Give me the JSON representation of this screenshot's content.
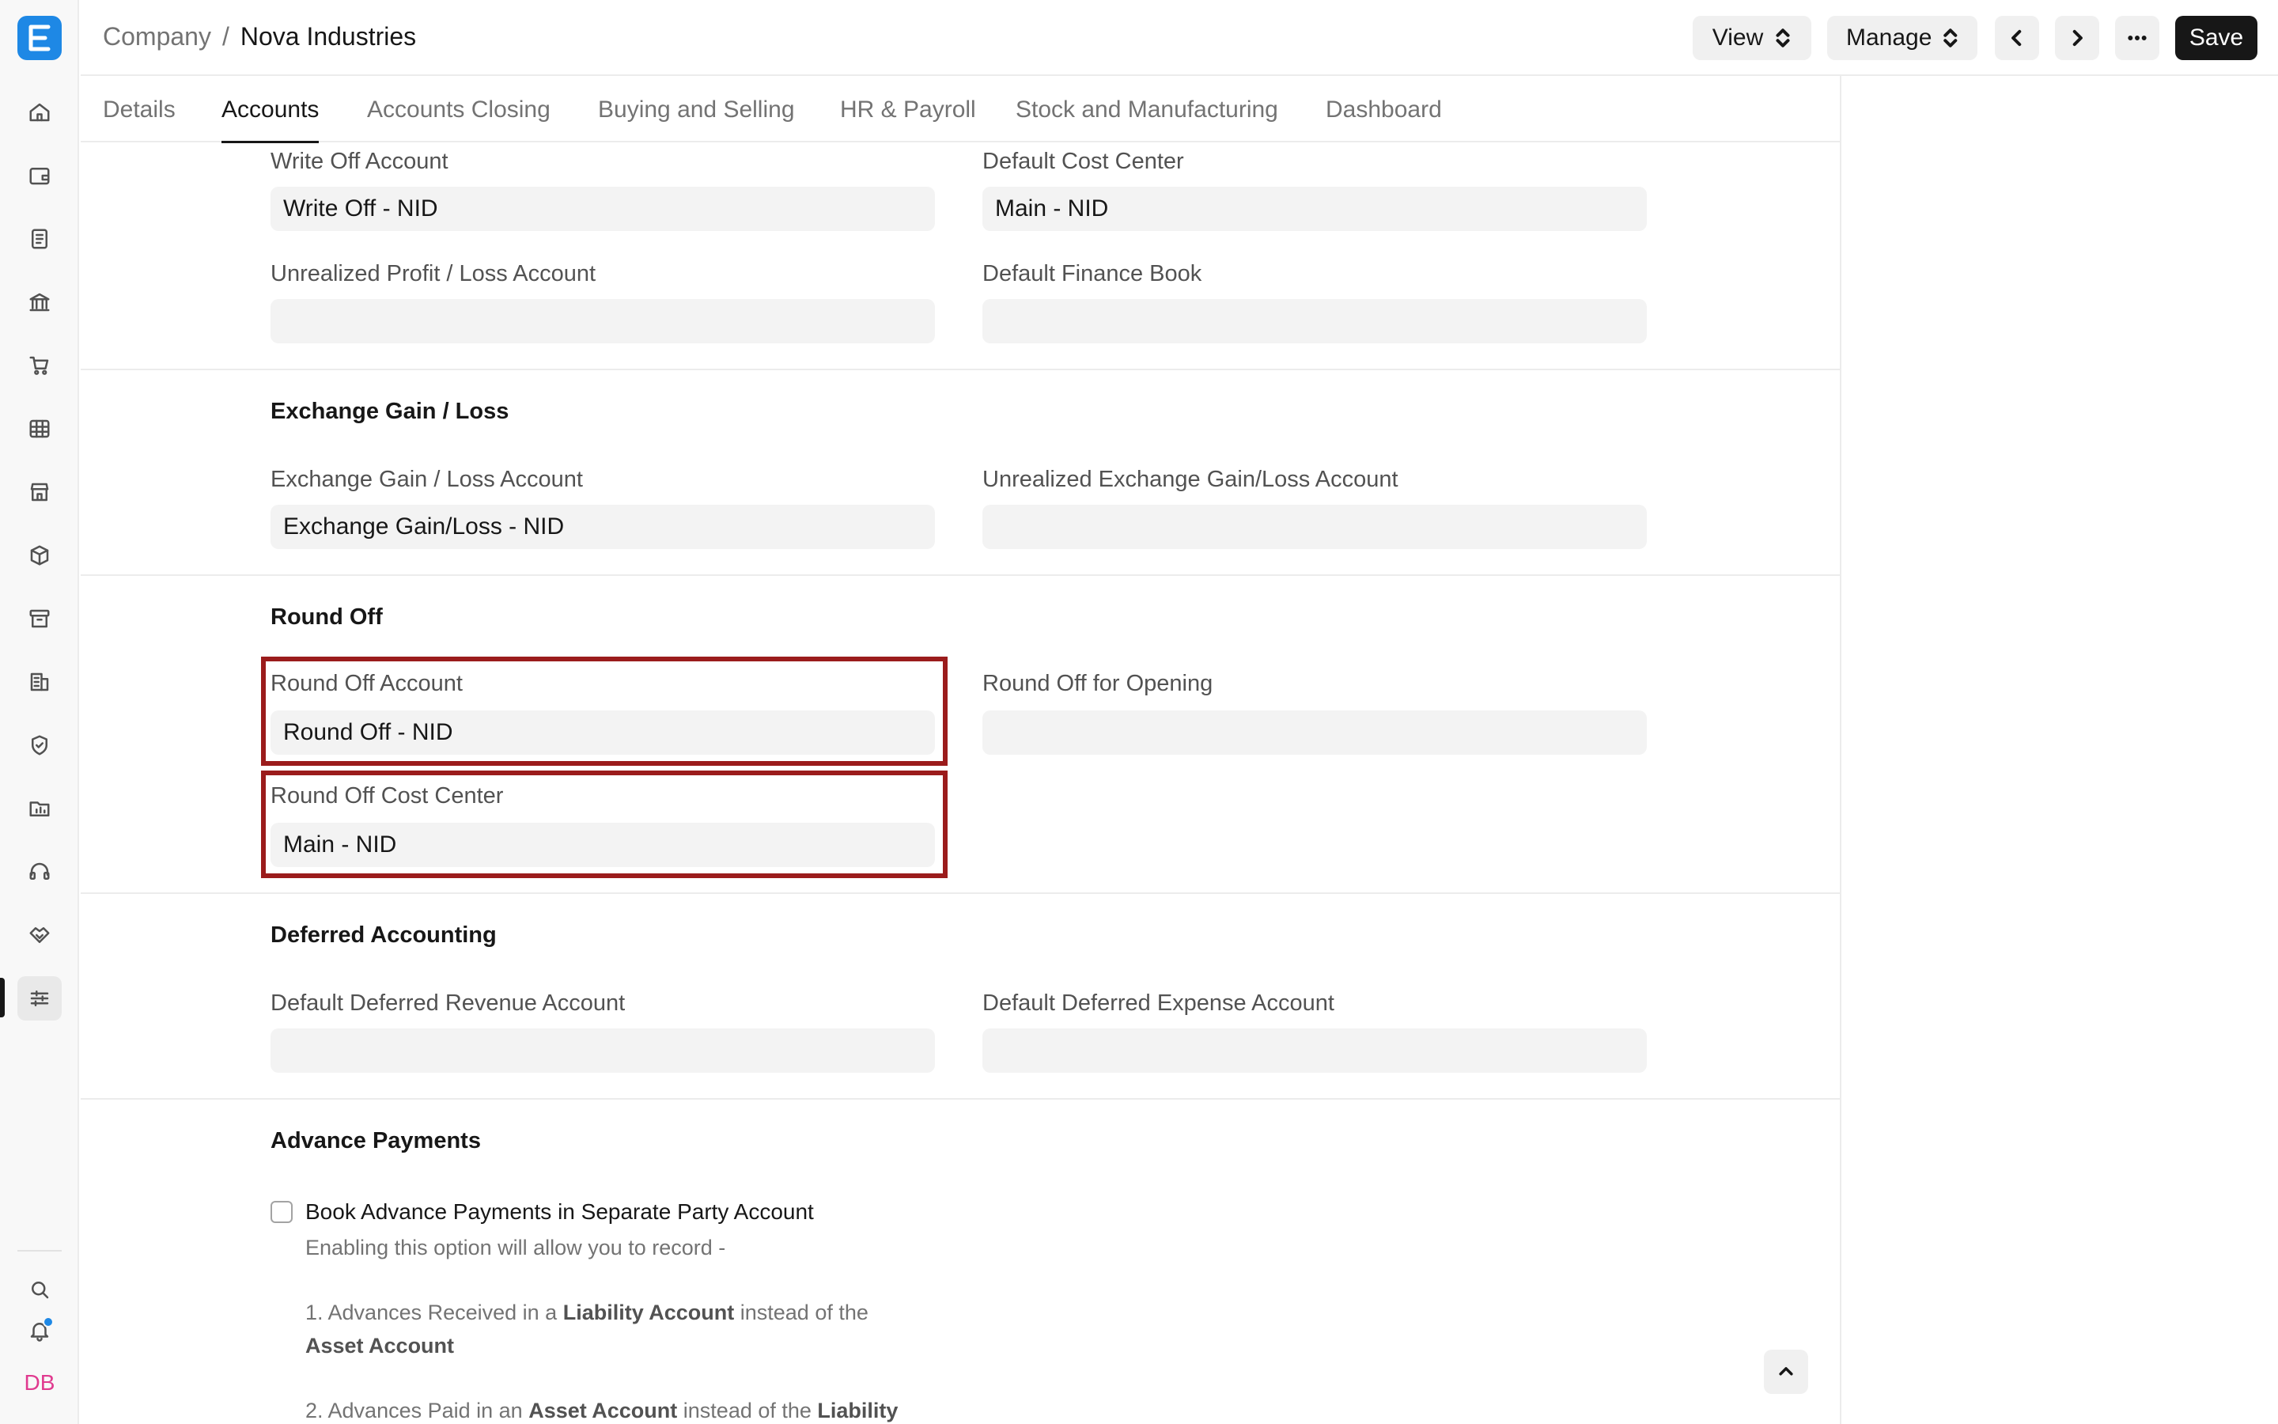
{
  "app": {
    "logo_letter": "E"
  },
  "header": {
    "breadcrumb_parent": "Company",
    "breadcrumb_separator": "/",
    "breadcrumb_current": "Nova Industries",
    "view_label": "View",
    "manage_label": "Manage",
    "save_label": "Save"
  },
  "tabs": [
    "Details",
    "Accounts",
    "Accounts Closing",
    "Buying and Selling",
    "HR & Payroll",
    "Stock and Manufacturing",
    "Dashboard"
  ],
  "active_tab": "Accounts",
  "sidebar": {
    "icons": [
      "home-icon",
      "wallet-icon",
      "document-icon",
      "bank-icon",
      "cart-icon",
      "table-icon",
      "store-icon",
      "box-icon",
      "archive-icon",
      "building-icon",
      "shield-icon",
      "folder-chart-icon",
      "headset-icon",
      "handshake-icon",
      "sliders-icon"
    ],
    "active": "sliders-icon",
    "user_initials": "DB"
  },
  "form": {
    "write_off_account": {
      "label": "Write Off Account",
      "value": "Write Off - NID"
    },
    "default_cost_center": {
      "label": "Default Cost Center",
      "value": "Main - NID"
    },
    "unrealized_pl_account": {
      "label": "Unrealized Profit / Loss Account",
      "value": ""
    },
    "default_finance_book": {
      "label": "Default Finance Book",
      "value": ""
    },
    "exchange_section": "Exchange Gain / Loss",
    "exchange_account": {
      "label": "Exchange Gain / Loss Account",
      "value": "Exchange Gain/Loss - NID"
    },
    "unrealized_exchange_account": {
      "label": "Unrealized Exchange Gain/Loss Account",
      "value": ""
    },
    "round_off_section": "Round Off",
    "round_off_account": {
      "label": "Round Off Account",
      "value": "Round Off - NID"
    },
    "round_off_opening": {
      "label": "Round Off for Opening",
      "value": ""
    },
    "round_off_cost_center": {
      "label": "Round Off Cost Center",
      "value": "Main - NID"
    },
    "deferred_section": "Deferred Accounting",
    "deferred_revenue": {
      "label": "Default Deferred Revenue Account",
      "value": ""
    },
    "deferred_expense": {
      "label": "Default Deferred Expense Account",
      "value": ""
    },
    "advance_section": "Advance Payments",
    "advance_checkbox": {
      "label": "Book Advance Payments in Separate Party Account",
      "checked": false
    },
    "advance_desc": {
      "intro": "Enabling this option will allow you to record -",
      "line1_a": "1. Advances Received in a",
      "line1_b": "Liability Account",
      "line1_c": "instead of the",
      "line1_d": "Asset Account",
      "line2_a": "2. Advances Paid in an",
      "line2_b": "Asset Account",
      "line2_c": "instead of the",
      "line2_d": "Liability"
    }
  },
  "colors": {
    "accent": "#1e88e5",
    "highlight": "#9b1c1c",
    "avatar": "#e03a8f"
  }
}
